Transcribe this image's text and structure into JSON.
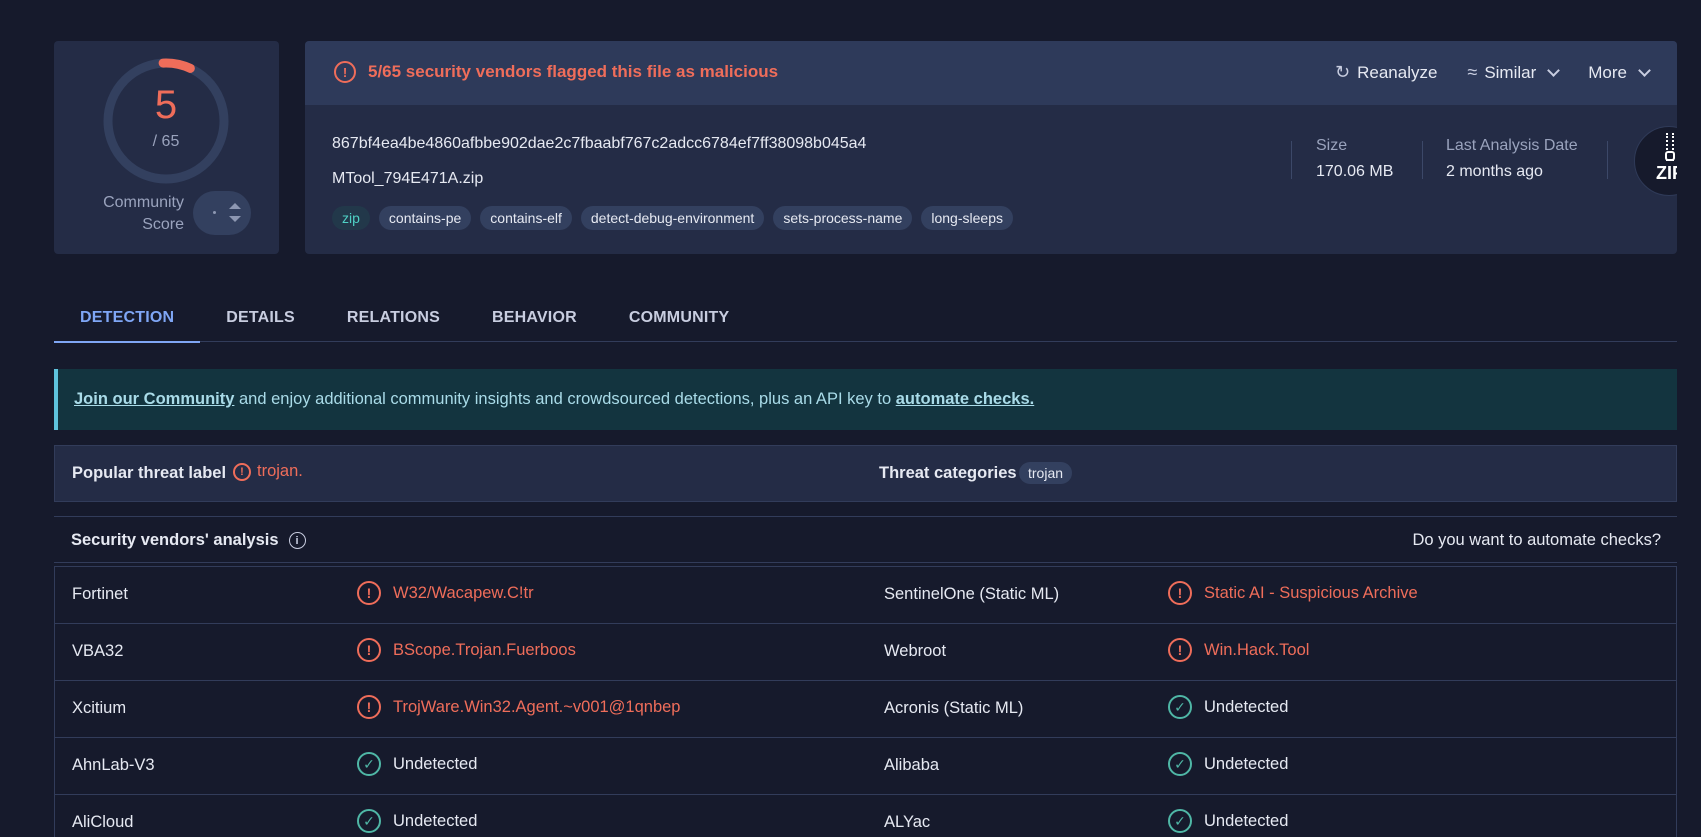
{
  "score": {
    "detections": "5",
    "total": "/ 65",
    "community_label": "Community Score",
    "fill_fraction": 0.077
  },
  "header": {
    "flag_text": "5/65 security vendors flagged this file as malicious",
    "reanalyze": "Reanalyze",
    "similar": "Similar",
    "more": "More"
  },
  "file": {
    "hash": "867bf4ea4be4860afbbe902dae2c7fbaabf767c2adcc6784ef7ff38098b045a4",
    "name": "MTool_794E471A.zip",
    "tags": [
      "zip",
      "contains-pe",
      "contains-elf",
      "detect-debug-environment",
      "sets-process-name",
      "long-sleeps"
    ],
    "size_label": "Size",
    "size_value": "170.06 MB",
    "date_label": "Last Analysis Date",
    "date_value": "2 months ago",
    "type_icon_text": "ZIP"
  },
  "tabs": [
    "DETECTION",
    "DETAILS",
    "RELATIONS",
    "BEHAVIOR",
    "COMMUNITY"
  ],
  "banner": {
    "link1": "Join our Community",
    "middle": " and enjoy additional community insights and crowdsourced detections, plus an API key to ",
    "link2": "automate checks."
  },
  "threat": {
    "popular_label": "Popular threat label",
    "popular_value": "trojan.",
    "categories_label": "Threat categories",
    "category": "trojan"
  },
  "vendors": {
    "title": "Security vendors' analysis",
    "automate": "Do you want to automate checks?",
    "rows": [
      {
        "v1": "Fortinet",
        "r1": "W32/Wacapew.C!tr",
        "s1": "bad",
        "v2": "SentinelOne (Static ML)",
        "r2": "Static AI - Suspicious Archive",
        "s2": "bad"
      },
      {
        "v1": "VBA32",
        "r1": "BScope.Trojan.Fuerboos",
        "s1": "bad",
        "v2": "Webroot",
        "r2": "Win.Hack.Tool",
        "s2": "bad"
      },
      {
        "v1": "Xcitium",
        "r1": "TrojWare.Win32.Agent.~v001@1qnbep",
        "s1": "bad",
        "v2": "Acronis (Static ML)",
        "r2": "Undetected",
        "s2": "good"
      },
      {
        "v1": "AhnLab-V3",
        "r1": "Undetected",
        "s1": "good",
        "v2": "Alibaba",
        "r2": "Undetected",
        "s2": "good"
      },
      {
        "v1": "AliCloud",
        "r1": "Undetected",
        "s1": "good",
        "v2": "ALYac",
        "r2": "Undetected",
        "s2": "good"
      }
    ]
  },
  "colors": {
    "malicious": "#ef6d5a",
    "clean": "#4fb7a6",
    "accent": "#7fa6f5"
  }
}
